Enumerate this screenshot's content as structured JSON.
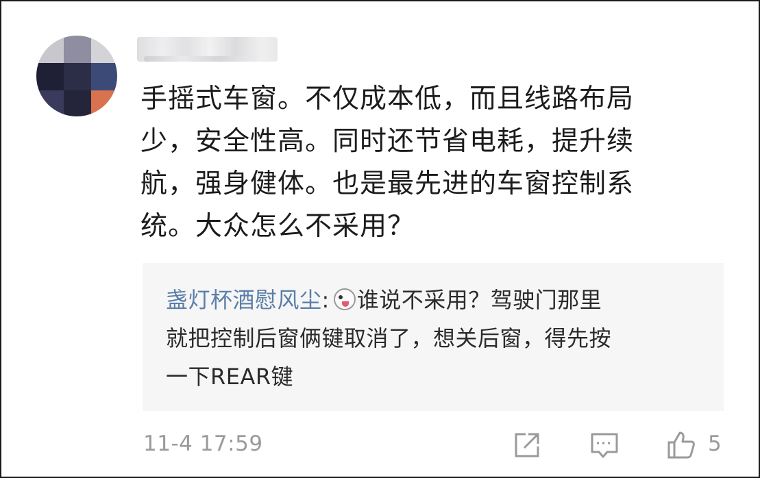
{
  "comment": {
    "text_lines": [
      "手摇式车窗。不仅成本低，而且线路布局",
      "少，安全性高。同时还节省电耗，提升续",
      "航，强身健体。也是最先进的车窗控制系",
      "统。大众怎么不采用？"
    ]
  },
  "reply": {
    "author": "盏灯杯酒慰风尘",
    "separator": ":",
    "emoji_icon": "face-emoji-icon",
    "line1_rest": "谁说不采用？驾驶门那里",
    "line2": "就把控制后窗俩键取消了，想关后窗，得先按",
    "line3": "一下REAR键"
  },
  "footer": {
    "timestamp": "11-4 17:59",
    "like_count": "5",
    "icons": [
      "share-icon",
      "comment-icon",
      "like-icon"
    ]
  },
  "colors": {
    "reply_author": "#5b7ea8",
    "reply_background": "#f6f6f6",
    "meta_gray": "#9a9a9a"
  }
}
